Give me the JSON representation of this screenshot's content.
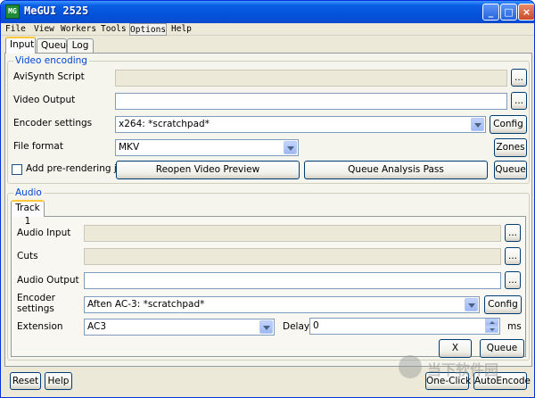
{
  "window": {
    "title": "MeGUI 2525",
    "app_icon": "megui-app-icon",
    "min_icon": "_",
    "max_icon": "□",
    "close_icon": "×"
  },
  "menu": [
    "File",
    "View",
    "Workers",
    "Tools",
    "Options",
    "Help"
  ],
  "tabs": [
    "Input",
    "Queue",
    "Log"
  ],
  "video": {
    "group_label": "Video encoding",
    "avisynth_label": "AviSynth Script",
    "avisynth_value": "",
    "output_label": "Video Output",
    "output_value": "",
    "encoder_label": "Encoder settings",
    "encoder_value": "x264: *scratchpad*",
    "format_label": "File format",
    "format_value": "MKV",
    "prerender_label": "Add pre-rendering job",
    "browse_label": "...",
    "config_label": "Config",
    "zones_label": "Zones",
    "reopen_label": "Reopen Video Preview",
    "queue_analysis_label": "Queue Analysis Pass",
    "queue_label": "Queue"
  },
  "audio": {
    "group_label": "Audio",
    "track_tab": "Track 1",
    "input_label": "Audio Input",
    "input_value": "",
    "cuts_label": "Cuts",
    "cuts_value": "",
    "output_label": "Audio Output",
    "output_value": "",
    "encoder_label_line1": "Encoder",
    "encoder_label_line2": "settings",
    "encoder_value": "Aften AC-3: *scratchpad*",
    "extension_label": "Extension",
    "extension_value": "AC3",
    "delay_label": "Delay",
    "delay_value": "0",
    "delay_unit": "ms",
    "browse_label": "...",
    "config_label": "Config",
    "x_label": "X",
    "queue_label": "Queue"
  },
  "bottom": {
    "reset_label": "Reset",
    "help_label": "Help",
    "oneclick_label": "One-Click",
    "autoencode_label": "AutoEncode"
  },
  "watermark_text": "当下软件园",
  "colors": {
    "titlebar": "#0353da",
    "group_label": "#0046d5",
    "tab_highlight": "#ffc83c"
  }
}
